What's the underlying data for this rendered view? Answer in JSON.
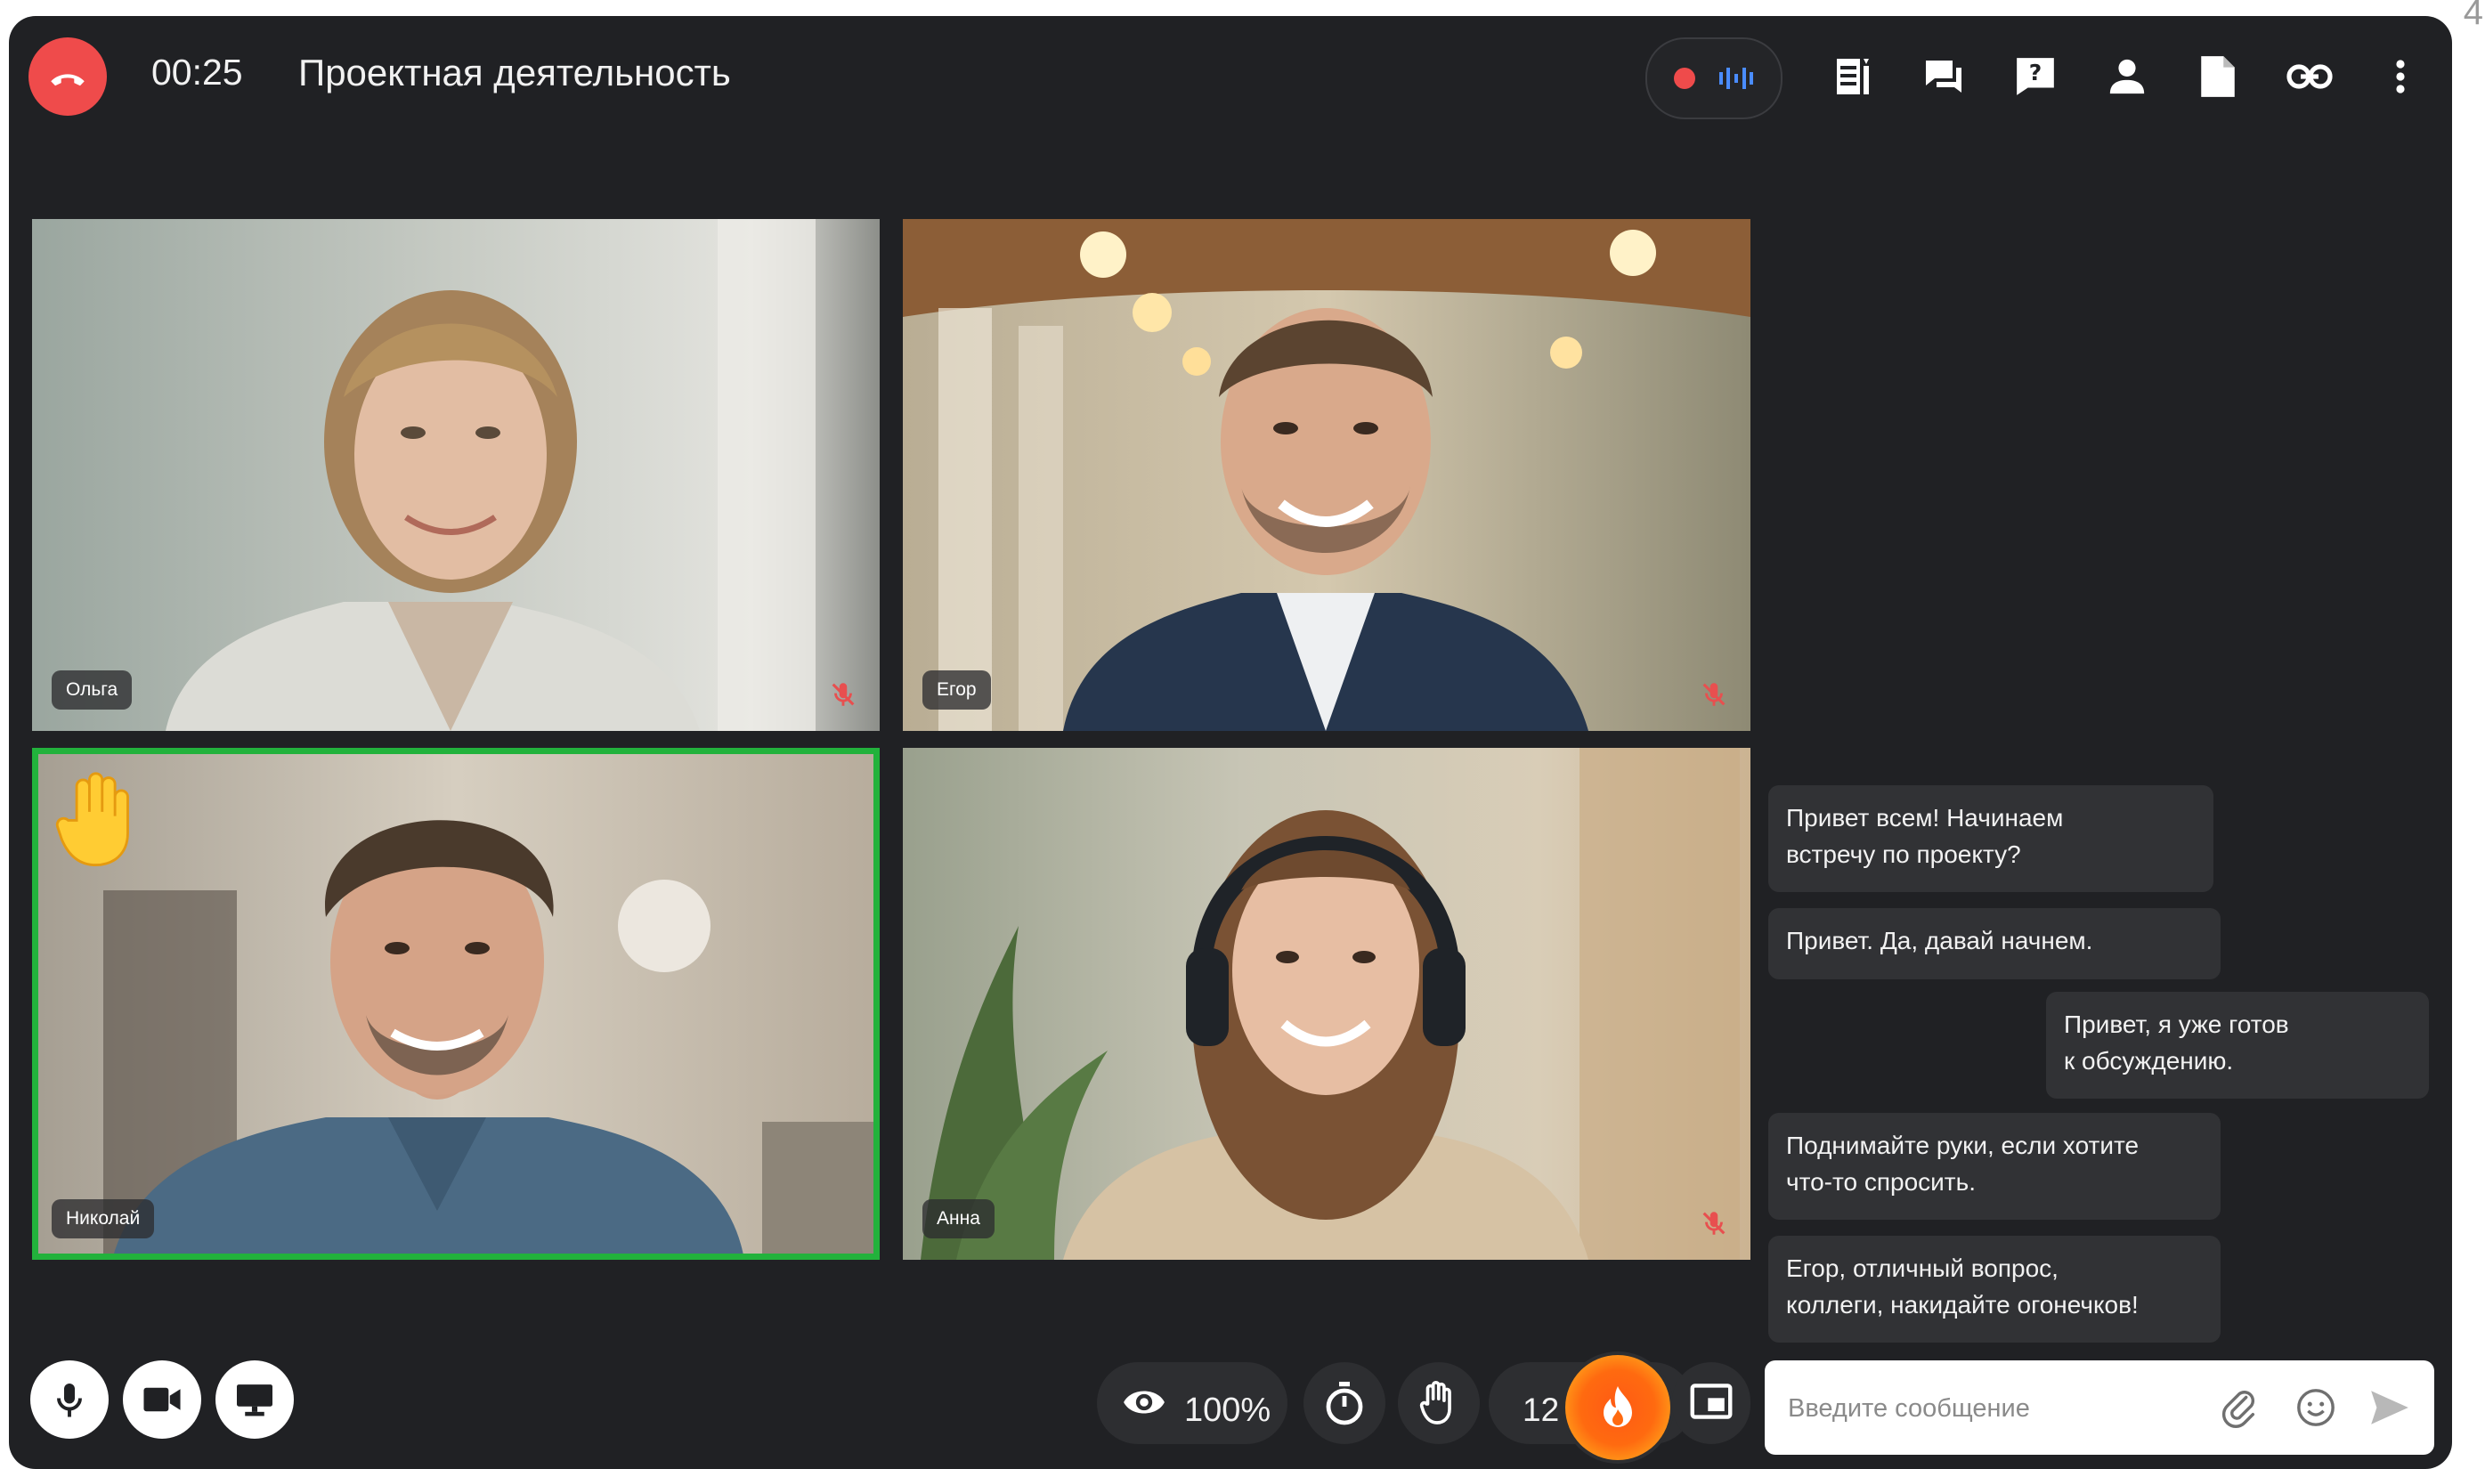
{
  "page_number": "4",
  "header": {
    "timer": "00:25",
    "title": "Проектная деятельность"
  },
  "toolbar_icons": [
    "record-dot-icon",
    "audio-wave-icon",
    "notes-icon",
    "chat-icon",
    "question-icon",
    "participants-icon",
    "document-icon",
    "link-icon",
    "more-icon"
  ],
  "participants": [
    {
      "name": "Ольга",
      "muted": true
    },
    {
      "name": "Егор",
      "muted": true
    },
    {
      "name": "Николай",
      "muted": false,
      "hand_raised": true,
      "active_speaker": true
    },
    {
      "name": "Анна",
      "muted": true
    }
  ],
  "chat": {
    "messages": [
      {
        "text": "Привет всем! Начинаем\nвстречу по проекту?",
        "side": "left"
      },
      {
        "text": "Привет. Да, давай начнем.",
        "side": "left"
      },
      {
        "text": "Привет, я уже готов\nк обсуждению.",
        "side": "right"
      },
      {
        "text": "Поднимайте руки, если хотите\nчто-то спросить.",
        "side": "left"
      },
      {
        "text": "Егор, отличный вопрос,\nколлеги, накидайте огонечков!",
        "side": "left"
      }
    ],
    "input_placeholder": "Введите сообщение"
  },
  "bottom_controls": {
    "zoom": "100%",
    "reactions_count": "12"
  },
  "colors": {
    "background": "#202124",
    "hangup": "#ef4b4b",
    "active_speaker": "#22b23c",
    "fire": "#ff6a10",
    "wave": "#4a8cff"
  }
}
